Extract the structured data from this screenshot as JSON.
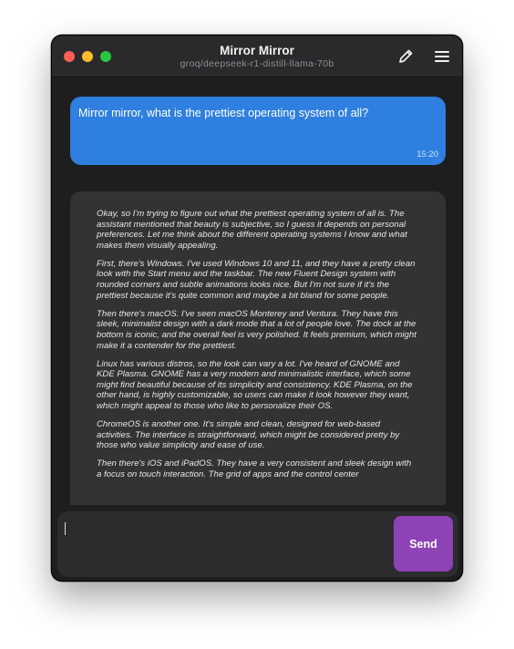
{
  "window": {
    "title": "Mirror Mirror",
    "subtitle": "groq/deepseek-r1-distill-llama-70b",
    "icons": [
      "close-dot",
      "minimize-dot",
      "maximize-dot",
      "pencil-edit-icon",
      "hamburger-menu-icon"
    ]
  },
  "messages": {
    "user": {
      "text": "Mirror mirror, what is the prettiest operating system of all?",
      "time": "15:20",
      "color": "#2f7fe0"
    },
    "assistant": {
      "paragraphs": [
        "Okay, so I'm trying to figure out what the prettiest operating system of all is. The assistant mentioned that beauty is subjective, so I guess it depends on personal preferences. Let me think about the different operating systems I know and what makes them visually appealing.",
        "First, there's Windows. I've used Windows 10 and 11, and they have a pretty clean look with the Start menu and the taskbar. The new Fluent Design system with rounded corners and subtle animations looks nice. But I'm not sure if it's the prettiest because it's quite common and maybe a bit bland for some people.",
        "Then there's macOS. I've seen macOS Monterey and Ventura. They have this sleek, minimalist design with a dark mode that a lot of people love. The dock at the bottom is iconic, and the overall feel is very polished. It feels premium, which might make it a contender for the prettiest.",
        "Linux has various distros, so the look can vary a lot. I've heard of GNOME and KDE Plasma. GNOME has a very modern and minimalistic interface, which some might find beautiful because of its simplicity and consistency. KDE Plasma, on the other hand, is highly customizable, so users can make it look however they want, which might appeal to those who like to personalize their OS.",
        "ChromeOS is another one. It's simple and clean, designed for web-based activities. The interface is straightforward, which might be considered pretty by those who value simplicity and ease of use.",
        "Then there's iOS and iPadOS. They have a very consistent and sleek design with a focus on touch interaction. The grid of apps and the control center"
      ]
    }
  },
  "composer": {
    "value": "",
    "send_label": "Send",
    "send_color": "#8d43b5"
  }
}
